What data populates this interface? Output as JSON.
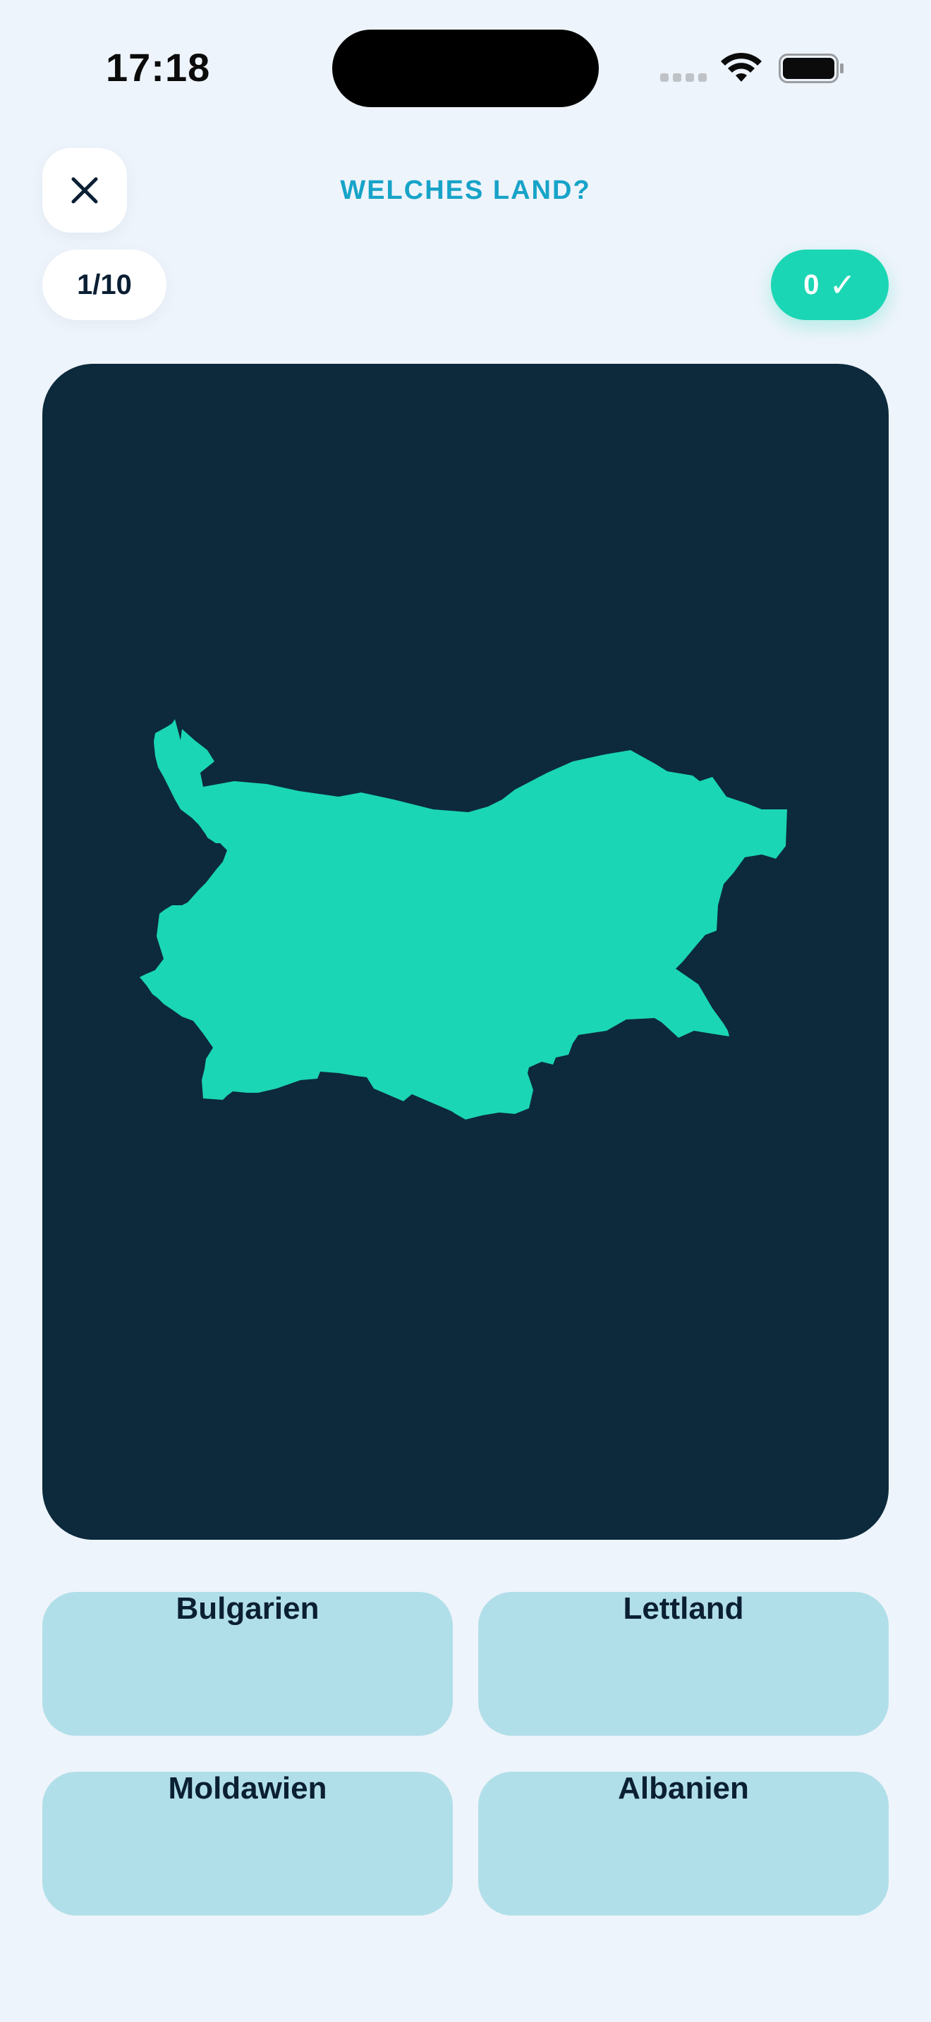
{
  "status_bar": {
    "time": "17:18",
    "icons": [
      "signal-icon",
      "wifi-icon",
      "battery-icon"
    ]
  },
  "header": {
    "close_icon": "close-icon",
    "title": "WELCHES LAND?"
  },
  "progress": {
    "text": "1/10"
  },
  "score": {
    "value": "0",
    "check": "✓"
  },
  "map": {
    "icon": "country-shape",
    "fill_color": "#1BD6B4",
    "background_color": "#0C2A3C"
  },
  "answers": [
    {
      "label": "Bulgarien"
    },
    {
      "label": "Lettland"
    },
    {
      "label": "Moldawien"
    },
    {
      "label": "Albanien"
    }
  ],
  "colors": {
    "accent": "#17A3C8",
    "score_bg": "#1BD6B4",
    "answer_bg": "#B1DFE9",
    "page_bg": "#EEF4FB"
  }
}
